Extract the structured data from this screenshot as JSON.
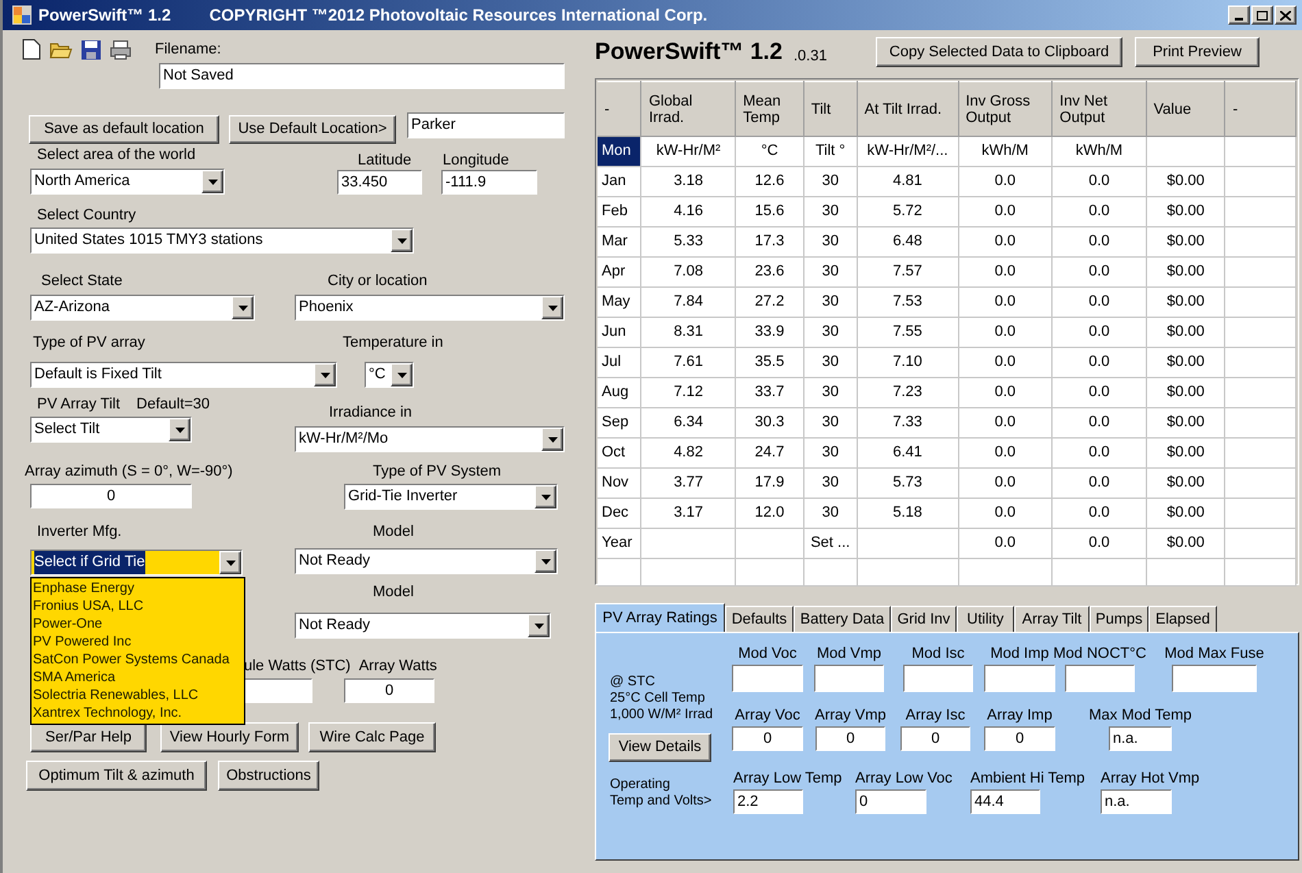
{
  "window": {
    "title": "PowerSwift™ 1.2",
    "copyright": "COPYRIGHT ™2012  Photovoltaic Resources International Corp."
  },
  "filename": {
    "label": "Filename:",
    "value": "Not Saved"
  },
  "location_buttons": [
    "Save as default location",
    "Use Default Location>"
  ],
  "default_location": {
    "value": "Parker"
  },
  "world_area": {
    "label": "Select area of the world",
    "value": "North America"
  },
  "latitude": {
    "label": "Latitude",
    "value": "33.450"
  },
  "longitude": {
    "label": "Longitude",
    "value": "-111.9"
  },
  "country": {
    "label": "Select Country",
    "value": "United States 1015 TMY3 stations"
  },
  "state": {
    "label": "Select State",
    "value": "AZ-Arizona"
  },
  "city": {
    "label": "City or location",
    "value": "Phoenix"
  },
  "pv_array_type": {
    "label": "Type of PV array",
    "value": "Default is Fixed Tilt"
  },
  "temperature_unit": {
    "label": "Temperature in",
    "value": "°C"
  },
  "tilt": {
    "label": "PV Array Tilt",
    "note": "Default=30",
    "value": "Select Tilt"
  },
  "irradiance_unit": {
    "label": "Irradiance in",
    "value": "kW-Hr/M²/Mo"
  },
  "azimuth": {
    "label": "Array azimuth (S = 0°, W=-90°)",
    "value": "0"
  },
  "pv_system": {
    "label": "Type of PV System",
    "value": "Grid-Tie Inverter"
  },
  "inverter_mfg": {
    "label": "Inverter Mfg.",
    "value": "Select if Grid Tie",
    "expanded": true,
    "options": [
      "Enphase Energy",
      "Fronius USA, LLC",
      "Power-One",
      "PV Powered Inc",
      "SatCon Power Systems Canada",
      "SMA America",
      "Solectria Renewables, LLC",
      "Xantrex Technology, Inc."
    ]
  },
  "inverter_model": {
    "label": "Model",
    "value": "Not Ready"
  },
  "second_model": {
    "label": "Model",
    "value": "Not Ready"
  },
  "module_watts": {
    "label": "ule Watts (STC)"
  },
  "array_watts": {
    "label": "Array Watts",
    "value": "0"
  },
  "action_buttons": [
    [
      "Ser/Par Help",
      "View Hourly Form",
      "Wire Calc Page"
    ],
    [
      "Optimum Tilt & azimuth",
      "Obstructions"
    ]
  ],
  "summary": {
    "title": "PowerSwift™ 1.2",
    "version": ".0.31"
  },
  "top_buttons": [
    "Copy Selected Data to Clipboard",
    "Print Preview"
  ],
  "table": {
    "columns": [
      "-",
      "Global Irrad.",
      "Mean Temp",
      "Tilt",
      "At Tilt Irrad.",
      "Inv Gross Output",
      "Inv Net Output",
      "Value",
      "-"
    ],
    "units": {
      "selected": true,
      "cells": [
        "Mon",
        "kW-Hr/M²",
        "°C",
        "Tilt °",
        "kW-Hr/M²/...",
        "kWh/M",
        "kWh/M",
        null,
        null
      ]
    },
    "rows": [
      {
        "cells": [
          "Jan",
          "3.18",
          "12.6",
          "30",
          "4.81",
          "0.0",
          "0.0",
          "$0.00",
          null
        ]
      },
      {
        "cells": [
          "Feb",
          "4.16",
          "15.6",
          "30",
          "5.72",
          "0.0",
          "0.0",
          "$0.00",
          null
        ]
      },
      {
        "cells": [
          "Mar",
          "5.33",
          "17.3",
          "30",
          "6.48",
          "0.0",
          "0.0",
          "$0.00",
          null
        ]
      },
      {
        "cells": [
          "Apr",
          "7.08",
          "23.6",
          "30",
          "7.57",
          "0.0",
          "0.0",
          "$0.00",
          null
        ]
      },
      {
        "cells": [
          "May",
          "7.84",
          "27.2",
          "30",
          "7.53",
          "0.0",
          "0.0",
          "$0.00",
          null
        ]
      },
      {
        "cells": [
          "Jun",
          "8.31",
          "33.9",
          "30",
          "7.55",
          "0.0",
          "0.0",
          "$0.00",
          null
        ]
      },
      {
        "cells": [
          "Jul",
          "7.61",
          "35.5",
          "30",
          "7.10",
          "0.0",
          "0.0",
          "$0.00",
          null
        ]
      },
      {
        "cells": [
          "Aug",
          "7.12",
          "33.7",
          "30",
          "7.23",
          "0.0",
          "0.0",
          "$0.00",
          null
        ]
      },
      {
        "cells": [
          "Sep",
          "6.34",
          "30.3",
          "30",
          "7.33",
          "0.0",
          "0.0",
          "$0.00",
          null
        ]
      },
      {
        "cells": [
          "Oct",
          "4.82",
          "24.7",
          "30",
          "6.41",
          "0.0",
          "0.0",
          "$0.00",
          null
        ]
      },
      {
        "cells": [
          "Nov",
          "3.77",
          "17.9",
          "30",
          "5.73",
          "0.0",
          "0.0",
          "$0.00",
          null
        ]
      },
      {
        "cells": [
          "Dec",
          "3.17",
          "12.0",
          "30",
          "5.18",
          "0.0",
          "0.0",
          "$0.00",
          null
        ]
      },
      {
        "cells": [
          "Year",
          null,
          null,
          "Set ...",
          null,
          "0.0",
          "0.0",
          "$0.00",
          null
        ]
      }
    ]
  },
  "tabs": [
    {
      "label": "PV Array Ratings",
      "selected": true
    },
    {
      "label": "Defaults",
      "selected": false
    },
    {
      "label": "Battery Data",
      "selected": false
    },
    {
      "label": "Grid Inv",
      "selected": false
    },
    {
      "label": "Utility",
      "selected": false
    },
    {
      "label": "Array Tilt",
      "selected": false
    },
    {
      "label": "Pumps",
      "selected": false
    },
    {
      "label": "Elapsed",
      "selected": false
    }
  ],
  "ratings": {
    "stc_note": [
      "@ STC",
      "25°C Cell Temp",
      "1,000 W/M² Irrad"
    ],
    "details_button": "View Details",
    "operating_note": [
      "Operating",
      "Temp and Volts>"
    ],
    "module_fields": [
      {
        "label": "Mod Voc"
      },
      {
        "label": "Mod Vmp"
      },
      {
        "label": "Mod Isc"
      },
      {
        "label": "Mod Imp"
      },
      {
        "label": "Mod NOCT°C"
      },
      {
        "label": "Mod Max Fuse"
      }
    ],
    "array_fields": [
      {
        "label": "Array Voc",
        "value": "0"
      },
      {
        "label": "Array Vmp",
        "value": "0"
      },
      {
        "label": "Array Isc",
        "value": "0"
      },
      {
        "label": "Array Imp",
        "value": "0"
      },
      {
        "label": "Max Mod Temp",
        "value": "n.a."
      }
    ],
    "operating_fields": [
      {
        "label": "Array Low Temp",
        "value": "2.2"
      },
      {
        "label": "Array Low Voc",
        "value": "0"
      },
      {
        "label": "Ambient Hi Temp",
        "value": "44.4"
      },
      {
        "label": "Array Hot Vmp",
        "value": "n.a."
      }
    ]
  }
}
